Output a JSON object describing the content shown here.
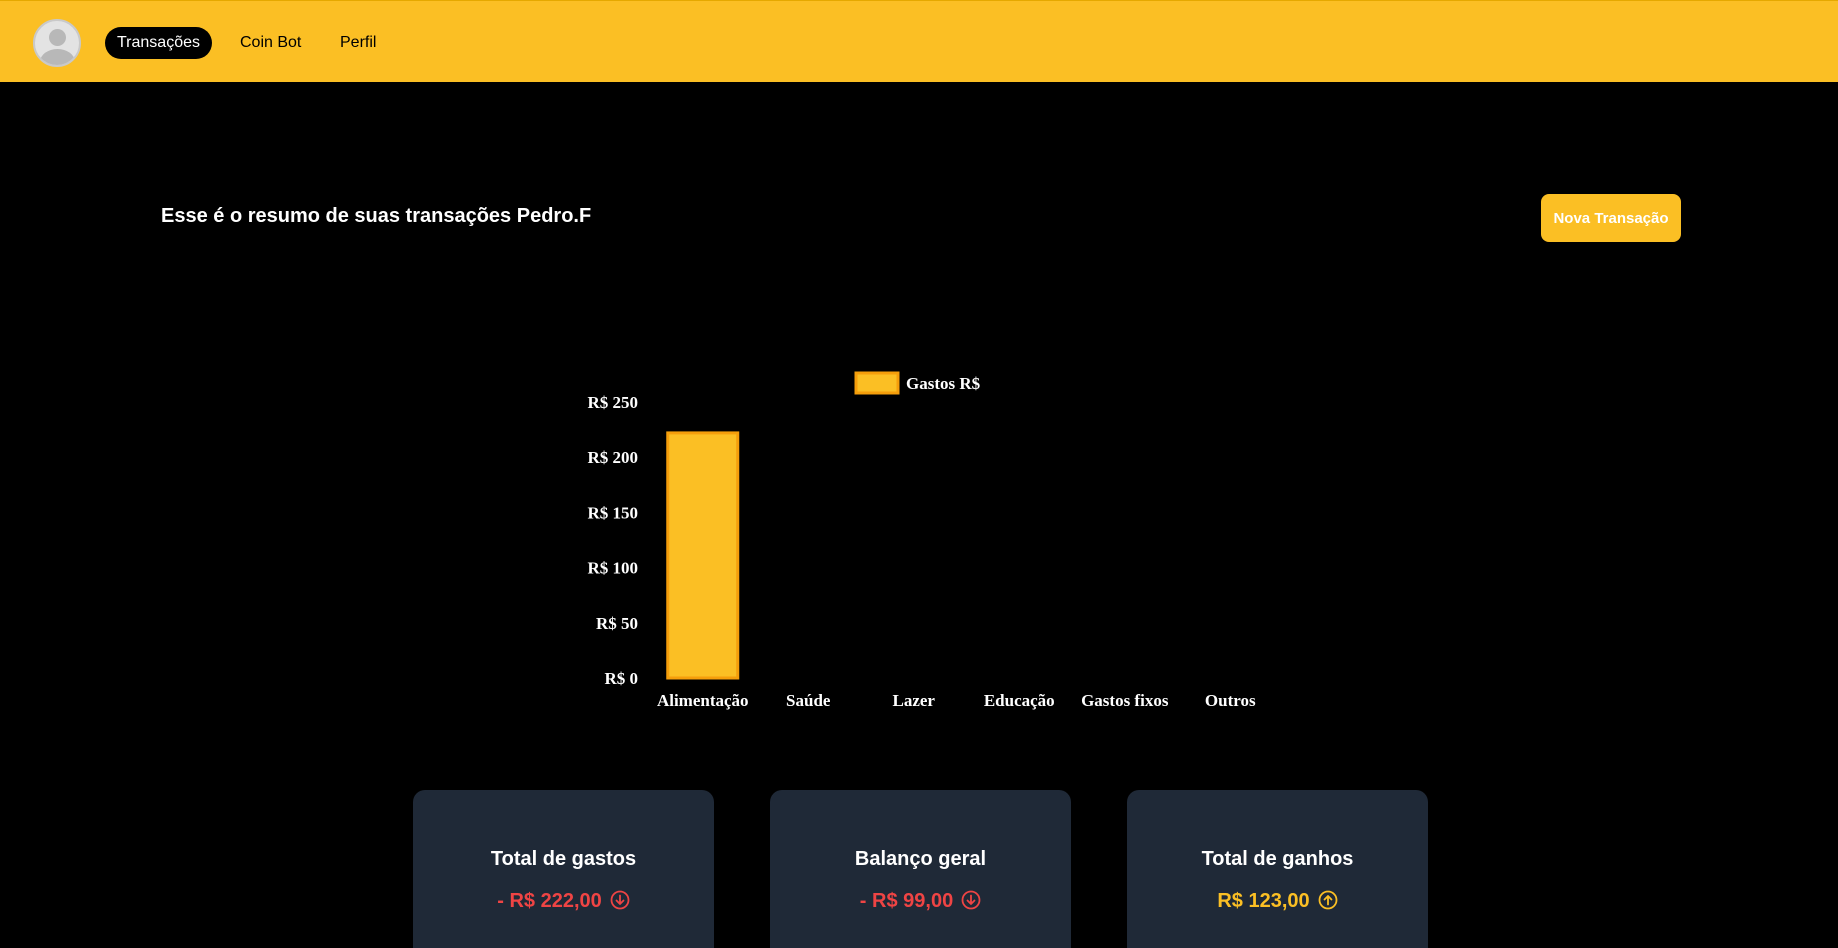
{
  "nav": {
    "items": [
      {
        "label": "Transações",
        "active": true
      },
      {
        "label": "Coin Bot",
        "active": false
      },
      {
        "label": "Perfil",
        "active": false
      }
    ]
  },
  "main": {
    "heading": "Esse é o resumo de suas transações Pedro.F",
    "new_transaction_label": "Nova Transação"
  },
  "chart_data": {
    "type": "bar",
    "categories": [
      "Alimentação",
      "Saúde",
      "Lazer",
      "Educação",
      "Gastos fixos",
      "Outros"
    ],
    "series": [
      {
        "name": "Gastos R$",
        "values": [
          222,
          0,
          0,
          0,
          0,
          0
        ]
      }
    ],
    "ylim": [
      0,
      250
    ],
    "yticks": [
      0,
      50,
      100,
      150,
      200,
      250
    ],
    "ytick_labels": [
      "R$ 0",
      "R$ 50",
      "R$ 100",
      "R$ 150",
      "R$ 200",
      "R$ 250"
    ],
    "legend": "top",
    "grid": false,
    "bar_color": "#fbbf24",
    "bar_border_color": "#f59e0b"
  },
  "summary": {
    "cards": [
      {
        "title": "Total de gastos",
        "value": "- R$ 222,00",
        "icon": "arrow-down-circle-icon",
        "status": "negative"
      },
      {
        "title": "Balanço geral",
        "value": "- R$ 99,00",
        "icon": "arrow-down-circle-icon",
        "status": "negative"
      },
      {
        "title": "Total de ganhos",
        "value": "R$ 123,00",
        "icon": "arrow-up-circle-icon",
        "status": "positive"
      }
    ]
  },
  "colors": {
    "accent": "#fbbf24",
    "negative": "#ef4444",
    "card_bg": "#1f2937",
    "background": "#000000"
  }
}
